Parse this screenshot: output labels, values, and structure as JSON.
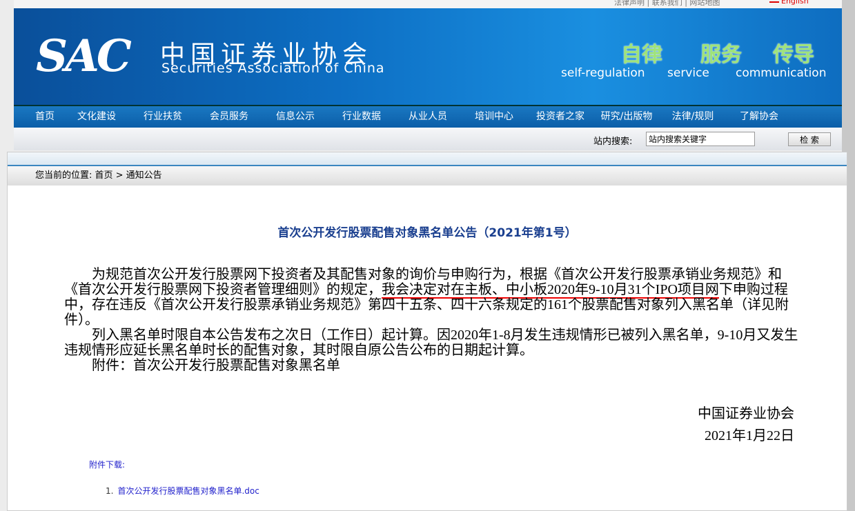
{
  "topbar": {
    "links": "法律声明 | 联系我们 | 网站地图",
    "english": "English"
  },
  "banner": {
    "logo": "SAC",
    "name_cn": "中国证券业协会",
    "name_en": "Securities Association of China",
    "slogans": [
      {
        "cn": "自律",
        "en": "self-regulation"
      },
      {
        "cn": "服务",
        "en": "service"
      },
      {
        "cn": "传导",
        "en": "communication"
      }
    ]
  },
  "nav": [
    "首页",
    "文化建设",
    "行业扶贫",
    "会员服务",
    "信息公示",
    "行业数据",
    "从业人员",
    "培训中心",
    "投资者之家",
    "研究/出版物",
    "法律/规则",
    "了解协会"
  ],
  "search": {
    "label": "站内搜索:",
    "value": "站内搜索关键字",
    "button": "检 索"
  },
  "breadcrumb": "您当前的位置: 首页 > 通知公告",
  "article": {
    "title": "首次公开发行股票配售对象黑名单公告（2021年第1号）",
    "p1a": "为规范首次公开发行股票网下投资者及其配售对象的询价与申购行为，根据《首次公开发行股票承销业务规范》和《首次公开发行股票网下投资者管理细则》的规定，",
    "p1b": "我会决定对在主板、中小板2020年9-10月31个IPO项目网",
    "p1c": "下申购过程中，存在违反《首次公开发行股票承销业务规范》第四十五条、四十六条规定的161个股票配售对象列入黑名单（详见附件）。",
    "p2": "列入黑名单时限自本公告发布之次日（工作日）起计算。因2020年1-8月发生违规情形已被列入黑名单，9-10月又发生违规情形应延长黑名单时长的配售对象，其时限自原公告公布的日期起计算。",
    "p3": "附件：首次公开发行股票配售对象黑名单",
    "signer": "中国证券业协会",
    "date": "2021年1月22日",
    "attach_label": "附件下载:",
    "files": [
      {
        "num": "1.",
        "name": "首次公开发行股票配售对象黑名单.doc"
      }
    ]
  }
}
